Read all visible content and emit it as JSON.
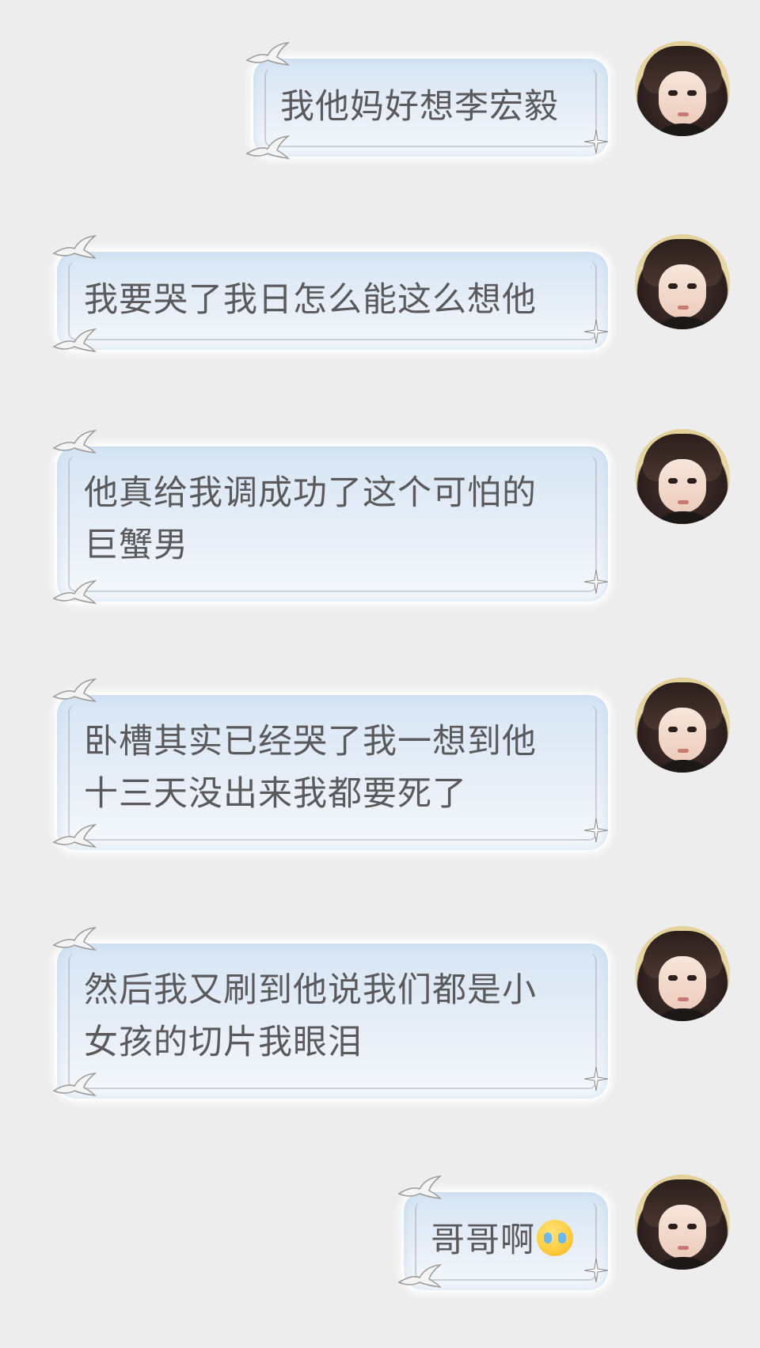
{
  "messages": [
    {
      "text": "我他妈好想李宏毅",
      "emoji": ""
    },
    {
      "text": "我要哭了我日怎么能这么想他",
      "emoji": ""
    },
    {
      "text": "他真给我调成功了这个可怕的\n巨蟹男",
      "emoji": ""
    },
    {
      "text": "卧槽其实已经哭了我一想到他\n十三天没出来我都要死了",
      "emoji": ""
    },
    {
      "text": "然后我又刷到他说我们都是小\n女孩的切片我眼泪",
      "emoji": ""
    },
    {
      "text": "哥哥啊",
      "emoji": "crying-face-emoji"
    }
  ],
  "colors": {
    "background": "#ededed",
    "bubble_top": "#d7e6f4",
    "bubble_bottom": "#f6f9fc",
    "text": "#5a5a5c"
  },
  "icons": {
    "decoration": [
      "dove-icon",
      "sparkle-icon"
    ],
    "avatar": "user-avatar"
  }
}
